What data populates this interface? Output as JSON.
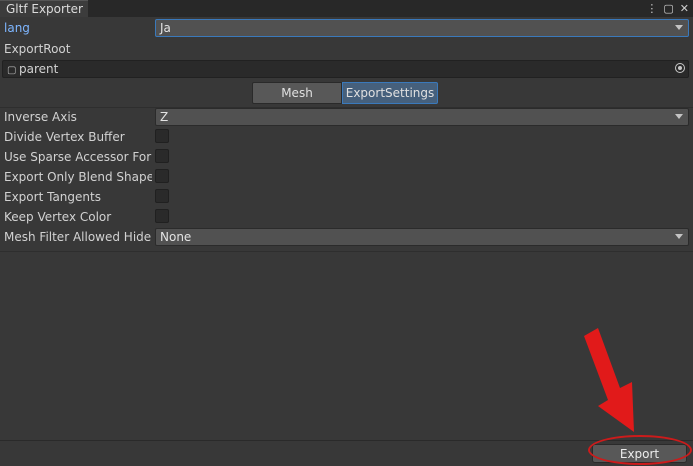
{
  "window": {
    "tab_title": "Gltf Exporter",
    "menu_icon": "kebab-menu-icon",
    "maximize_icon": "maximize-icon",
    "close_icon": "close-icon"
  },
  "lang": {
    "label": "lang",
    "value": "Ja"
  },
  "export_root": {
    "label": "ExportRoot",
    "value": "parent",
    "icon": "gameobject-cube-icon",
    "picker_icon": "object-picker-icon"
  },
  "toolbar": {
    "tabs": [
      "Mesh",
      "ExportSettings"
    ],
    "selected": "ExportSettings"
  },
  "settings": {
    "inverse_axis": {
      "label": "Inverse Axis",
      "value": "Z"
    },
    "divide_vertex_buffer": {
      "label": "Divide Vertex Buffer",
      "checked": false
    },
    "use_sparse_accessor": {
      "label": "Use Sparse Accessor For M",
      "checked": false
    },
    "export_only_blend_shape": {
      "label": "Export Only Blend Shape P",
      "checked": false
    },
    "export_tangents": {
      "label": "Export Tangents",
      "checked": false
    },
    "keep_vertex_color": {
      "label": "Keep Vertex Color",
      "checked": false
    },
    "mesh_filter_hide": {
      "label": "Mesh Filter Allowed Hide F",
      "value": "None"
    }
  },
  "footer": {
    "export_label": "Export"
  },
  "annotation": {
    "color": "#e11a1a",
    "arrow": "red-arrow-pointing-to-export"
  }
}
